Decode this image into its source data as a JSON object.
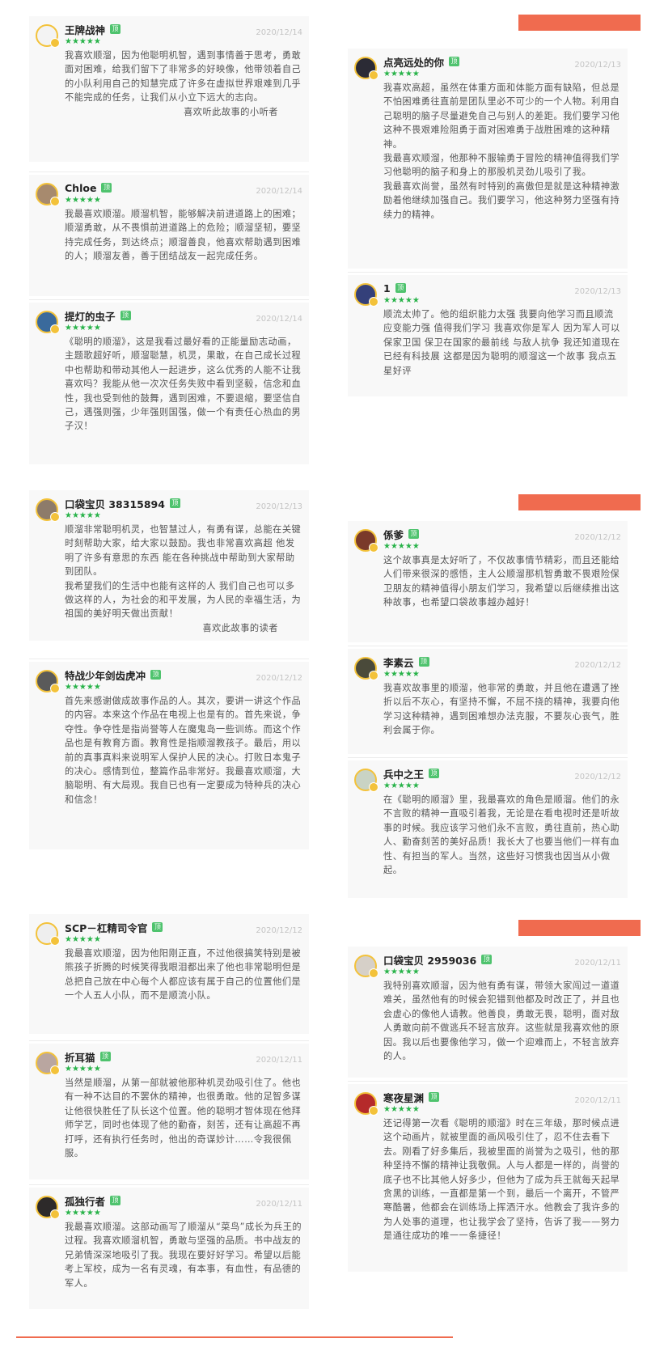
{
  "stars": "★★★★★",
  "badge": "顶",
  "colors": {
    "accent_bar": "#f06b4f",
    "star": "#29b34a",
    "badge": "#4fc36e",
    "card_bg": "#f8f8f8"
  },
  "reviews": [
    {
      "name": "王牌战神",
      "date": "2020/12/14",
      "text": "我喜欢顺溜，因为他聪明机智，遇到事情善于思考，勇敢面对困难，给我们留下了非常多的好映像，他带领着自己的小队利用自己的知慧完成了许多在虚拟世界艰难到几乎不能完成的任务，让我们从小立下远大的志向。",
      "sign": "喜欢听此故事的小听者"
    },
    {
      "name": "Chloe",
      "date": "2020/12/14",
      "text": "我最喜欢顺溜。顺溜机智，能够解决前进道路上的困难；顺溜勇敢，从不畏惧前进道路上的危险；顺溜坚韧，要坚持完成任务，到达终点；顺溜善良，他喜欢帮助遇到困难的人；顺溜友善，善于团结战友一起完成任务。"
    },
    {
      "name": "提灯的虫子",
      "date": "2020/12/14",
      "text": "《聪明的顺溜》，这是我看过最好看的正能量励志动画，主题歌超好听，顺溜聪慧，机灵，果敢，在自己成长过程中也帮助和带动其他人一起进步，这么优秀的人能不让我喜欢吗？我能从他一次次任务失败中看到坚毅，信念和血性，我也受到他的鼓舞，遇到困难，不要退缩，要坚信自己，遇强则强，少年强则国强，做一个有责任心热血的男子汉！"
    },
    {
      "name": "点亮远处的你",
      "date": "2020/12/13",
      "text": "我喜欢高超，虽然在体重方面和体能方面有缺陷，但总是不怕困难勇往直前是团队里必不可少的一个人物。利用自己聪明的脑子尽量避免自己与别人的差距。我们要学习他这种不畏艰难险阻勇于面对困难勇于战胜困难的这种精神。",
      "text2": "我最喜欢顺溜，他那种不服输勇于冒险的精神值得我们学习他聪明的脑子和身上的那股机灵劲儿吸引了我。",
      "text3": "我最喜欢尚誉，虽然有时特别的高傲但是就是这种精神激励着他继续加强自己。我们要学习，他这种努力坚强有持续力的精神。"
    },
    {
      "name": "1",
      "date": "2020/12/13",
      "text": "顺流太帅了。他的组织能力太强 我要向他学习而且顺流应变能力强 值得我们学习 我喜欢你是军人 因为军人可以保家卫国 保卫在国家的最前线 与敌人抗争 我还知道现在已经有科技展 这都是因为聪明的顺溜这一个故事 我点五星好评"
    },
    {
      "name": "口袋宝贝 38315894",
      "date": "2020/12/13",
      "text": "顺溜非常聪明机灵，也智慧过人，有勇有谋，总能在关键时刻帮助大家，给大家以鼓励。我也非常喜欢高超 他发明了许多有意思的东西 能在各种挑战中帮助到大家帮助到团队。",
      "text2": "我希望我们的生活中也能有这样的人 我们自己也可以多做这样的人，为社会的和平发展，为人民的幸福生活，为祖国的美好明天做出贡献！",
      "sign": "喜欢此故事的读者"
    },
    {
      "name": "特战少年剑齿虎冲",
      "date": "2020/12/12",
      "text": "首先来感谢做成故事作品的人。其次，要讲一讲这个作品的内容。本来这个作品在电视上也是有的。首先来说，争夺性。争夺性是指尚誉等人在魔鬼岛一些训练。而这个作品也是有教育方面。教育性是指顺溜教孩子。最后，用以前的真事真料来说明军人保护人民的决心。打败日本鬼子的决心。感情到位，整篇作品非常好。我最喜欢顺溜，大脑聪明、有大局观。我自已也有一定要成为特种兵的决心和信念！"
    },
    {
      "name": "係爹",
      "date": "2020/12/12",
      "text": "这个故事真是太好听了，不仅故事情节精彩，而且还能给人们带来很深的感悟，主人公顺溜那机智勇敢不畏艰险保卫朋友的精神值得小朋友们学习，我希望以后继续推出这种故事，也希望口袋故事越办越好！"
    },
    {
      "name": "李素云",
      "date": "2020/12/12",
      "text": "我喜欢故事里的顺溜，他非常的勇敢，并且他在遭遇了挫折以后不灰心，有坚持不懈，不屈不挠的精神，我要向他学习这种精神，遇到困难想办法克服，不要灰心丧气，胜利会属于你。"
    },
    {
      "name": "兵中之王",
      "date": "2020/12/12",
      "text": "在《聪明的顺溜》里，我最喜欢的角色是顺溜。他们的永不言败的精神一直吸引着我，无论是在看电视时还是听故事的时候。我应该学习他们永不言败，勇往直前，热心助人、勤奋刻苦的美好品质！我长大了也要当他们一样有血性、有担当的军人。当然，这些好习惯我也因当从小做起。"
    },
    {
      "name": "SCP－杠精司令官",
      "date": "2020/12/12",
      "text": "我最喜欢顺溜，因为他阳刚正直，不过他很搞笑特别是被熊孩子折腾的时候笑得我眼泪都出来了他也非常聪明但是总把自己放在中心每个人都应该有属于自己的位置他们是一个人五人小队，而不是顺流小队。"
    },
    {
      "name": "折耳猫",
      "date": "2020/12/11",
      "text": "当然是顺溜，从第一部就被他那种机灵劲吸引住了。他也有一种不达目的不罢休的精神，也很勇敢。他的足智多谋让他很快胜任了队长这个位置。他的聪明才智体现在他拜师学艺，同时也体现了他的勤奋，刻苦，还有让高超不再打呼，还有执行任务时，他出的奇谋妙计……令我很佩服。"
    },
    {
      "name": "孤独行者",
      "date": "2020/12/11",
      "text": "我最喜欢顺溜。这部动画写了顺溜从“菜鸟”成长为兵王的过程。我喜欢顺溜机智，勇敢与坚强的品质。书中战友的兄弟情深深地吸引了我。我现在要好好学习。希望以后能考上军校，成为一名有灵魂，有本事，有血性，有品德的军人。"
    },
    {
      "name": "口袋宝贝 2959036",
      "date": "2020/12/11",
      "text": "我特别喜欢顺溜，因为他有勇有谋，带领大家闯过一道道难关，虽然他有的时候会犯错到他都及时改正了，并且也会虚心的像他人请教。他善良，勇敢无畏，聪明，面对敌人勇敢向前不做逃兵不轻言放弃。这些就是我喜欢他的原因。我以后也要像他学习，做一个迎难而上，不轻言放弃的人。"
    },
    {
      "name": "寒夜星渊",
      "date": "2020/12/11",
      "text": "还记得第一次看《聪明的顺溜》时在三年级，那时候点进这个动画片，就被里面的画风吸引住了，忍不住去看下去。刚看了好多集后，我被里面的尚誉为之吸引，他的那种坚持不懈的精神让我敬佩。人与人都是一样的，尚誉的底子也不比其他人好多少，但他为了成为兵王就每天起早贪黑的训练，一直都是第一个到，最后一个离开，不管严寒酷暑，他都会在训练场上挥洒汗水。他教会了我许多的为人处事的道理，也让我学会了坚持，告诉了我——努力是通往成功的唯一一条捷径！"
    }
  ]
}
